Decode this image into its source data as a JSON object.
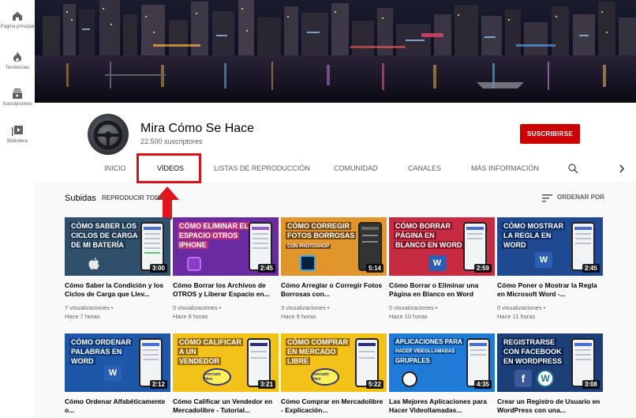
{
  "sidebar": {
    "items": [
      {
        "label": "Página principal",
        "icon": "home-icon"
      },
      {
        "label": "Tendencias",
        "icon": "fire-icon"
      },
      {
        "label": "Suscripciones",
        "icon": "subscriptions-icon"
      },
      {
        "label": "Biblioteca",
        "icon": "library-icon"
      }
    ]
  },
  "channel": {
    "name": "Mira Cómo Se Hace",
    "subscribers": "22.500 suscriptores",
    "subscribe_label": "SUSCRIBIRSE"
  },
  "tabs": [
    {
      "label": "INICIO"
    },
    {
      "label": "VÍDEOS"
    },
    {
      "label": "LISTAS DE REPRODUCCIÓN"
    },
    {
      "label": "COMUNIDAD"
    },
    {
      "label": "CANALES"
    },
    {
      "label": "MÁS INFORMACIÓN"
    }
  ],
  "active_tab": "VÍDEOS",
  "uploads": {
    "title": "Subidas",
    "play_all": "REPRODUCIR TODO",
    "sort_label": "ORDENAR POR"
  },
  "colors": {
    "accent_red": "#cc0000",
    "highlight_red": "#d6141a"
  },
  "videos": [
    {
      "thumb_text": [
        "CÓMO SABER LOS",
        "CICLOS DE CARGA",
        "DE MI BATERÍA"
      ],
      "duration": "3:00",
      "title": "Cómo Saber la Condición y los Ciclos de Carga que Llev...",
      "views": "7 visualizaciones •",
      "age": "Hace 7 horas"
    },
    {
      "thumb_text": [
        "CÓMO ELIMINAR EL",
        "ESPACIO OTROS",
        "IPHONE"
      ],
      "duration": "2:45",
      "title": "Cómo Borrar los Archivos de OTROS y Liberar Espacio en...",
      "views": "0 visualizaciones •",
      "age": "Hace 8 horas"
    },
    {
      "thumb_text": [
        "CÓMO CORREGIR",
        "FOTOS BORROSAS",
        "CON PHOTOSHOP"
      ],
      "duration": "5:14",
      "title": "Cómo Arreglar o Corregir Fotos Borrosas con...",
      "views": "3 visualizaciones •",
      "age": "Hace 9 horas"
    },
    {
      "thumb_text": [
        "CÓMO BORRAR",
        "PÁGINA EN",
        "BLANCO EN WORD"
      ],
      "duration": "2:59",
      "title": "Cómo Borrar o Eliminar una Página en Blanco en Word",
      "views": "0 visualizaciones •",
      "age": "Hace 10 horas"
    },
    {
      "thumb_text": [
        "CÓMO MOSTRAR",
        "LA REGLA EN",
        "WORD"
      ],
      "duration": "2:45",
      "title": "Cómo Poner o Mostrar la Regla en Microsoft Word -...",
      "views": "0 visualizaciones •",
      "age": "Hace 11 horas"
    },
    {
      "thumb_text": [
        "CÓMO ORDENAR",
        "PALABRAS EN",
        "WORD"
      ],
      "duration": "2:12",
      "title": "Cómo Ordenar Alfabéticamente o...",
      "views": "",
      "age": ""
    },
    {
      "thumb_text": [
        "CÓMO CALIFICAR",
        "A UN",
        "VENDEDOR"
      ],
      "duration": "3:21",
      "title": "Cómo Calificar un Vendedor en Mercadolibre - Tutorial...",
      "views": "",
      "age": ""
    },
    {
      "thumb_text": [
        "CÓMO COMPRAR",
        "EN MERCADO",
        "LIBRE"
      ],
      "duration": "5:22",
      "title": "Cómo Comprar en Mercadolibre - Explicación...",
      "views": "",
      "age": ""
    },
    {
      "thumb_text": [
        "APLICACIONES PARA",
        "HACER VIDEOLLAMADAS",
        "GRUPALES"
      ],
      "duration": "4:35",
      "title": "Las Mejores Aplicaciones para Hacer Videollamadas...",
      "views": "",
      "age": ""
    },
    {
      "thumb_text": [
        "REGISTRARSE",
        "CON FACEBOOK",
        "EN WORDPRESS"
      ],
      "duration": "3:08",
      "title": "Crear un Registro de Usuario en WordPress con una...",
      "views": "",
      "age": ""
    }
  ],
  "logo_text": {
    "mercado_libre": "mercado libre"
  }
}
